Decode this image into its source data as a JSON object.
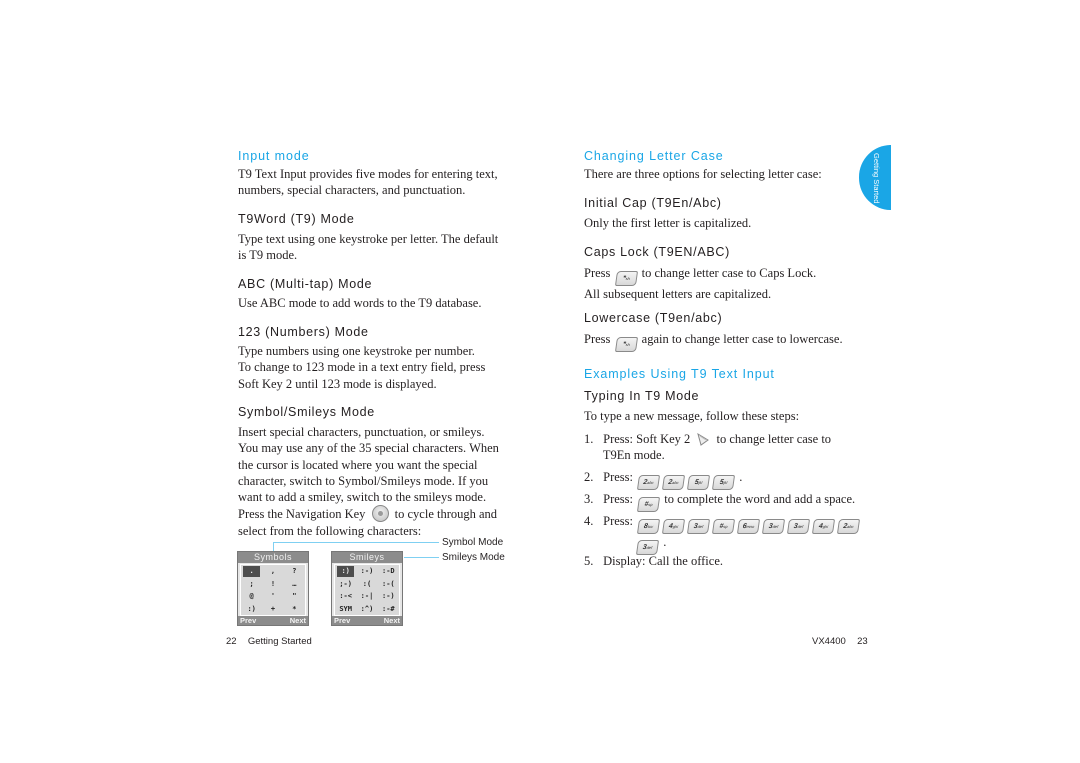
{
  "left_page": {
    "input_mode": {
      "heading": "Input mode",
      "lines": [
        "T9 Text Input provides five modes for entering text,",
        "numbers, special characters, and punctuation."
      ]
    },
    "t9word": {
      "heading": "T9Word (T9) Mode",
      "lines": [
        "Type text using one keystroke per letter. The default",
        "is T9 mode."
      ]
    },
    "abc": {
      "heading": "ABC (Multi-tap) Mode",
      "lines": [
        "Use ABC mode to add words to the T9 database."
      ]
    },
    "numbers": {
      "heading": "123 (Numbers) Mode",
      "lines": [
        "Type numbers using one keystroke per number.",
        "To change to 123 mode in a text entry field, press",
        "Soft Key 2 until 123 mode is displayed."
      ]
    },
    "symbol": {
      "heading": "Symbol/Smileys Mode",
      "lines": [
        "Insert special characters, punctuation, or smileys.",
        "You may use any of the 35 special characters. When",
        "the cursor is located where you want the special",
        "character, switch to Symbol/Smileys mode. If you",
        "want to add a smiley, switch to the smileys mode."
      ],
      "nav_before": "Press the Navigation Key",
      "nav_after": "to cycle through and",
      "last_line": "select from the following characters:"
    },
    "screens": {
      "symbols": {
        "title": "Symbols",
        "cells": [
          ".",
          ",",
          "?",
          ";",
          "!",
          "…",
          "@",
          "'",
          "\"",
          ":)",
          "+",
          "*"
        ],
        "left_soft": "Prev",
        "right_soft": "Next",
        "callout": "Symbol Mode"
      },
      "smileys": {
        "title": "Smileys",
        "cells": [
          ":)",
          ":-)",
          ":-D",
          ";-)",
          ":(",
          ":-(",
          ":-<",
          ":-|",
          ":-)",
          "SYM",
          ":^)",
          ":-#"
        ],
        "left_soft": "Prev",
        "right_soft": "Next",
        "callout": "Smileys Mode"
      }
    },
    "footer": {
      "page_number": "22",
      "section": "Getting Started"
    }
  },
  "right_page": {
    "changing_case": {
      "heading": "Changing Letter Case",
      "lines": [
        "There are three options for selecting letter case:"
      ]
    },
    "initial_cap": {
      "heading": "Initial Cap (T9En/Abc)",
      "lines": [
        "Only the first letter is capitalized."
      ]
    },
    "caps_lock": {
      "heading": "Caps Lock (T9EN/ABC)",
      "before": "Press",
      "after": "to change letter case to Caps Lock.",
      "line2": "All subsequent letters are capitalized.",
      "key": "*"
    },
    "lowercase": {
      "heading": "Lowercase (T9en/abc)",
      "before": "Press",
      "after": "again to change letter case to lowercase.",
      "key": "*"
    },
    "examples": {
      "heading": "Examples Using T9 Text Input",
      "subheading": "Typing In T9 Mode",
      "intro": "To type a new message, follow these steps:",
      "steps": [
        {
          "num": "1.",
          "before": "Press: Soft Key 2",
          "after": "to change letter case to",
          "cont": "T9En mode."
        },
        {
          "num": "2.",
          "before": "Press:",
          "keys": [
            "2",
            "2",
            "5",
            "5"
          ],
          "after": "."
        },
        {
          "num": "3.",
          "before": "Press:",
          "keys": [
            "#"
          ],
          "after": "to complete the word and add a space."
        },
        {
          "num": "4.",
          "before": "Press:",
          "keys": [
            "8",
            "4",
            "3",
            "#",
            "6",
            "3",
            "3",
            "4",
            "2"
          ],
          "cont_keys": [
            "3"
          ],
          "after": "."
        },
        {
          "num": "5.",
          "text": "Display: Call the office."
        }
      ]
    },
    "side_tab": "Getting Started",
    "footer": {
      "model": "VX4400",
      "page_number": "23"
    }
  },
  "colors": {
    "accent_blue": "#1aa6e6",
    "body_text": "#231f20",
    "screen_bar": "#8c8c8c"
  }
}
